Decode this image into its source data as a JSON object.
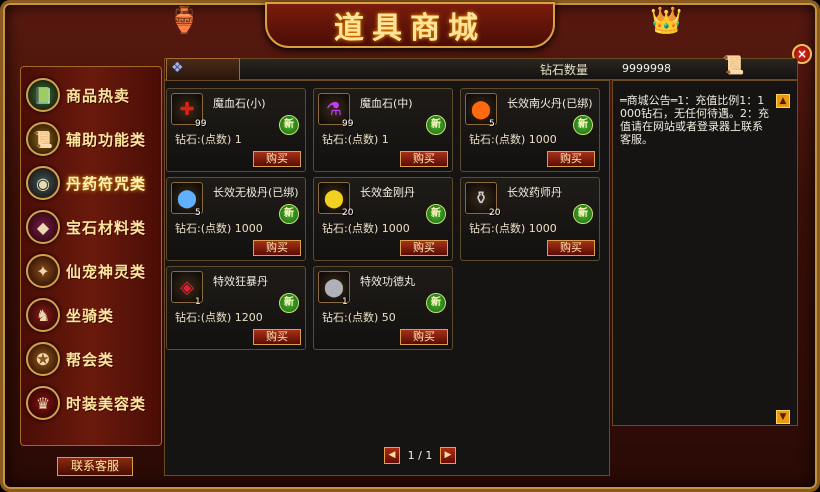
{
  "window": {
    "title": "道具商城",
    "close_label": "×"
  },
  "sidebar": {
    "items": [
      {
        "label": "商品热卖",
        "icon": "book-icon",
        "color": "#2a7a3a",
        "glyph": "📗"
      },
      {
        "label": "辅助功能类",
        "icon": "scroll-icon",
        "color": "#8a6a1a",
        "glyph": "📜"
      },
      {
        "label": "丹药符咒类",
        "icon": "pill-icon",
        "color": "#3a5a5a",
        "glyph": "◉"
      },
      {
        "label": "宝石材料类",
        "icon": "gem-icon",
        "color": "#7a1a4a",
        "glyph": "◆"
      },
      {
        "label": "仙宠神灵类",
        "icon": "pet-icon",
        "color": "#8a4a1a",
        "glyph": "✦"
      },
      {
        "label": "坐骑类",
        "icon": "mount-icon",
        "color": "#8a1a1a",
        "glyph": "♞"
      },
      {
        "label": "帮会类",
        "icon": "guild-icon",
        "color": "#9a5a1a",
        "glyph": "✪"
      },
      {
        "label": "时装美容类",
        "icon": "fashion-icon",
        "color": "#8a1010",
        "glyph": "♛"
      }
    ],
    "active_index": 2,
    "contact_label": "联系客服"
  },
  "topbar": {
    "diamond_label": "钻石数量",
    "diamond_value": "9999998"
  },
  "products": [
    {
      "name": "魔血石(小)",
      "qty": "99",
      "price": "钻石:(点数) 1",
      "new": "新",
      "buy": "购买",
      "icon": "red-crystal-icon",
      "glyph": "✚",
      "glyph_color": "#e02010"
    },
    {
      "name": "魔血石(中)",
      "qty": "99",
      "price": "钻石:(点数) 1",
      "new": "新",
      "buy": "购买",
      "icon": "purple-potion-icon",
      "glyph": "⚗",
      "glyph_color": "#c040f0"
    },
    {
      "name": "长效南火丹(已绑)",
      "qty": "5",
      "price": "钻石:(点数) 1000",
      "new": "新",
      "buy": "购买",
      "icon": "fire-pill-icon",
      "glyph": "⬤",
      "glyph_color": "#ff6a10"
    },
    {
      "name": "长效无极丹(已绑)",
      "qty": "5",
      "price": "钻石:(点数) 1000",
      "new": "新",
      "buy": "购买",
      "icon": "blue-orb-icon",
      "glyph": "⬤",
      "glyph_color": "#60b0ff"
    },
    {
      "name": "长效金刚丹",
      "qty": "20",
      "price": "钻石:(点数) 1000",
      "new": "新",
      "buy": "购买",
      "icon": "gold-orb-icon",
      "glyph": "⬤",
      "glyph_color": "#f0d020"
    },
    {
      "name": "长效药师丹",
      "qty": "20",
      "price": "钻石:(点数) 1000",
      "new": "新",
      "buy": "购买",
      "icon": "medicine-bottle-icon",
      "glyph": "⚱",
      "glyph_color": "#d0d0d0"
    },
    {
      "name": "特效狂暴丹",
      "qty": "1",
      "price": "钻石:(点数) 1200",
      "new": "新",
      "buy": "购买",
      "icon": "red-box-icon",
      "glyph": "◈",
      "glyph_color": "#e02030"
    },
    {
      "name": "特效功德丸",
      "qty": "1",
      "price": "钻石:(点数) 50",
      "new": "新",
      "buy": "购买",
      "icon": "silver-pearl-icon",
      "glyph": "⬤",
      "glyph_color": "#b0b0b8"
    }
  ],
  "notice": {
    "text": "═商城公告═1：充值比例1：1000钻石，无任何待遇。2：充值请在网站或者登录器上联系客服。"
  },
  "pager": {
    "page_text": "1 / 1",
    "prev": "◀",
    "next": "▶"
  }
}
